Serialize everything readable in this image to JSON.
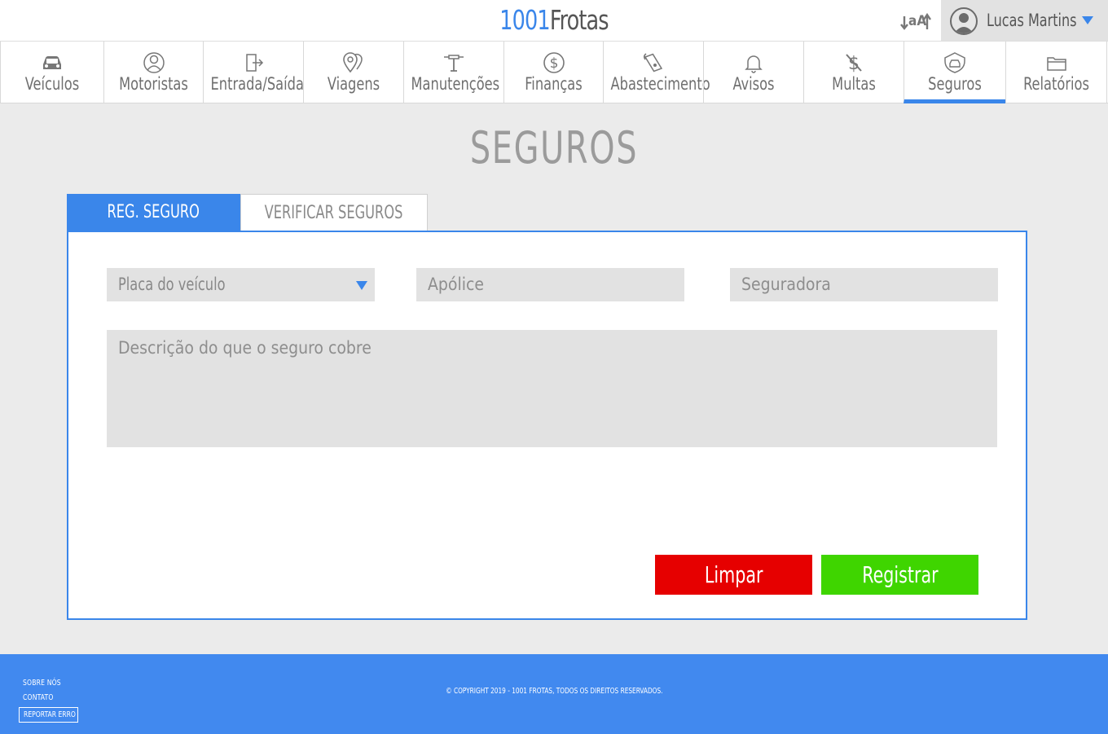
{
  "app": {
    "logo_number": "1001",
    "logo_name": "Frotas"
  },
  "header": {
    "font_toggle_label": "aA",
    "user_name": "Lucas Martins"
  },
  "nav": {
    "items": [
      {
        "label": "Veículos",
        "icon": "car-icon"
      },
      {
        "label": "Motoristas",
        "icon": "driver-icon"
      },
      {
        "label": "Entrada/Saída",
        "icon": "door-exit-icon"
      },
      {
        "label": "Viagens",
        "icon": "map-pin-icon"
      },
      {
        "label": "Manutenções",
        "icon": "wrench-icon"
      },
      {
        "label": "Finanças",
        "icon": "dollar-coin-icon"
      },
      {
        "label": "Abastecimento",
        "icon": "fuel-pump-icon"
      },
      {
        "label": "Avisos",
        "icon": "bell-icon"
      },
      {
        "label": "Multas",
        "icon": "no-money-icon"
      },
      {
        "label": "Seguros",
        "icon": "insured-car-icon"
      },
      {
        "label": "Relatórios",
        "icon": "folder-icon"
      }
    ],
    "active": "Seguros"
  },
  "main": {
    "title": "SEGUROS",
    "tabs": [
      {
        "label": "REG. SEGURO",
        "active": true
      },
      {
        "label": "VERIFICAR SEGUROS",
        "active": false
      }
    ],
    "form": {
      "placa_placeholder": "Placa do veículo",
      "apolice_placeholder": "Apólice",
      "seguradora_placeholder": "Seguradora",
      "descricao_placeholder": "Descrição do que o seguro cobre",
      "clear_label": "Limpar",
      "submit_label": "Registrar"
    }
  },
  "footer": {
    "about": "SOBRE NÓS",
    "contact": "CONTATO",
    "report": "REPORTAR ERRO",
    "copyright": "© COPYRIGHT 2019 - 1001 FROTAS, TODOS OS DIREITOS RESERVADOS."
  },
  "colors": {
    "accent": "#3a86ea",
    "footer": "#4189ef",
    "danger": "#e60000",
    "success": "#3fd500"
  }
}
